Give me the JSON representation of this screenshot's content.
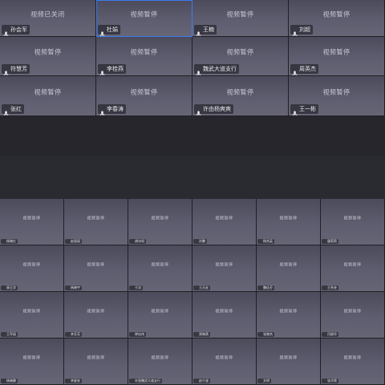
{
  "colors": {
    "background": "#26262c",
    "tile_gradient_top": "#4c4b5b",
    "tile_gradient_bottom": "#666576",
    "active_border": "#3d7bf0",
    "status_text": "#c9c8d4"
  },
  "top_grid": {
    "tiles": [
      {
        "status": "视频已关闭",
        "name": "孙会军",
        "active": false
      },
      {
        "status": "视频暂停",
        "name": "杜娟",
        "active": true
      },
      {
        "status": "视频暂停",
        "name": "王楠",
        "active": false
      },
      {
        "status": "视频暂停",
        "name": "刘超",
        "active": false
      },
      {
        "status": "视频暂停",
        "name": "符慧芳",
        "active": false
      },
      {
        "status": "视频暂停",
        "name": "李桂燕",
        "active": false
      },
      {
        "status": "视频暂停",
        "name": "魏武大道支行",
        "active": false
      },
      {
        "status": "视频暂停",
        "name": "周英杰",
        "active": false
      },
      {
        "status": "视频暂停",
        "name": "张红",
        "active": false
      },
      {
        "status": "视频暂停",
        "name": "李春涛",
        "active": false
      },
      {
        "status": "视频暂停",
        "name": "许由杨爽爽",
        "active": false
      },
      {
        "status": "视频暂停",
        "name": "王一彬",
        "active": false
      }
    ]
  },
  "bottom_grid": {
    "tiles": [
      {
        "status": "视频暂停",
        "name": "杨晓红"
      },
      {
        "status": "视频暂停",
        "name": "赵丽丽"
      },
      {
        "status": "视频暂停",
        "name": "胡冰如"
      },
      {
        "status": "视频暂停",
        "name": "孙鹏"
      },
      {
        "status": "视频暂停",
        "name": "杨秀英"
      },
      {
        "status": "视频暂停",
        "name": "唐莉莉"
      },
      {
        "status": "视频暂停",
        "name": "周玉华"
      },
      {
        "status": "视频暂停",
        "name": "杨晓宇"
      },
      {
        "status": "视频暂停",
        "name": "于洋"
      },
      {
        "status": "视频暂停",
        "name": "王天宏"
      },
      {
        "status": "视频暂停",
        "name": "魏佳芬"
      },
      {
        "status": "视频暂停",
        "name": "王秀芸"
      },
      {
        "status": "视频暂停",
        "name": "王军丽"
      },
      {
        "status": "视频暂停",
        "name": "李芳芳"
      },
      {
        "status": "视频暂停",
        "name": "钟佳伟"
      },
      {
        "status": "视频暂停",
        "name": "郑晓燕"
      },
      {
        "status": "视频暂停",
        "name": "张晓杰"
      },
      {
        "status": "视频暂停",
        "name": "闫俊玲"
      },
      {
        "status": "视频暂停",
        "name": "杨晓静"
      },
      {
        "status": "视频暂停",
        "name": "李星芸"
      },
      {
        "status": "视频暂停",
        "name": "许昌魏武大道支行"
      },
      {
        "status": "视频暂停",
        "name": "赵宁波"
      },
      {
        "status": "视频暂停",
        "name": "文明"
      },
      {
        "status": "视频暂停",
        "name": "张华荣"
      }
    ]
  }
}
